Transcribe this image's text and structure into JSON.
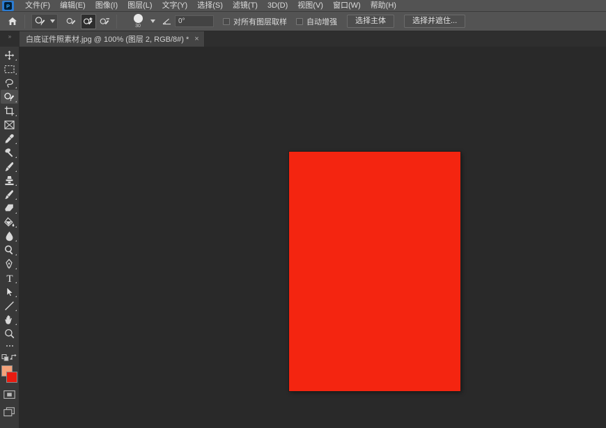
{
  "app": {
    "logo_icon": "photoshop-logo-icon",
    "accent_color": "#2b7cd3",
    "ui_bg": "#535353",
    "workspace_bg": "#292929"
  },
  "menubar": {
    "items": [
      {
        "label": "文件(F)",
        "name": "menu-file"
      },
      {
        "label": "编辑(E)",
        "name": "menu-edit"
      },
      {
        "label": "图像(I)",
        "name": "menu-image"
      },
      {
        "label": "图层(L)",
        "name": "menu-layer"
      },
      {
        "label": "文字(Y)",
        "name": "menu-type"
      },
      {
        "label": "选择(S)",
        "name": "menu-select"
      },
      {
        "label": "滤镜(T)",
        "name": "menu-filter"
      },
      {
        "label": "3D(D)",
        "name": "menu-3d"
      },
      {
        "label": "视图(V)",
        "name": "menu-view"
      },
      {
        "label": "窗口(W)",
        "name": "menu-window"
      },
      {
        "label": "帮助(H)",
        "name": "menu-help"
      }
    ]
  },
  "options_bar": {
    "home_icon": "home-icon",
    "tool_preview_icon": "quick-selection-tool-icon",
    "tool_preview_chevron": "chevron-down-icon",
    "modes": [
      {
        "name": "new-selection-mode",
        "icon": "quick-selection-new-icon",
        "active": false
      },
      {
        "name": "add-to-selection-mode",
        "icon": "quick-selection-add-icon",
        "active": true
      },
      {
        "name": "subtract-from-selection-mode",
        "icon": "quick-selection-subtract-icon",
        "active": false
      }
    ],
    "brush_size": "30",
    "brush_chevron": "chevron-down-icon",
    "angle_icon": "angle-icon",
    "angle_value": "0°",
    "checkboxes": [
      {
        "label": "对所有图层取样",
        "name": "sample-all-layers-checkbox",
        "checked": false
      },
      {
        "label": "自动增强",
        "name": "auto-enhance-checkbox",
        "checked": false
      }
    ],
    "buttons": [
      {
        "label": "选择主体",
        "name": "select-subject-button"
      },
      {
        "label": "选择并遮住...",
        "name": "select-and-mask-button"
      }
    ]
  },
  "tabbar": {
    "collapse_icon": "collapse-panel-icon",
    "collapse_label": "»",
    "document": {
      "title": "白底证件照素材.jpg @ 100% (图层 2, RGB/8#) *",
      "close_label": "×"
    }
  },
  "toolbar": {
    "tools": [
      {
        "name": "move-tool",
        "icon": "move-icon",
        "active": false,
        "has_submenu": true
      },
      {
        "name": "rectangular-marquee-tool",
        "icon": "marquee-icon",
        "active": false,
        "has_submenu": true
      },
      {
        "name": "lasso-tool",
        "icon": "lasso-icon",
        "active": false,
        "has_submenu": true
      },
      {
        "name": "quick-selection-tool",
        "icon": "quick-selection-icon",
        "active": true,
        "has_submenu": true
      },
      {
        "name": "crop-tool",
        "icon": "crop-icon",
        "active": false,
        "has_submenu": true
      },
      {
        "name": "frame-tool",
        "icon": "frame-icon",
        "active": false,
        "has_submenu": false
      },
      {
        "name": "eyedropper-tool",
        "icon": "eyedropper-icon",
        "active": false,
        "has_submenu": true
      },
      {
        "name": "spot-healing-brush-tool",
        "icon": "healing-brush-icon",
        "active": false,
        "has_submenu": true
      },
      {
        "name": "brush-tool",
        "icon": "brush-icon",
        "active": false,
        "has_submenu": true
      },
      {
        "name": "clone-stamp-tool",
        "icon": "clone-stamp-icon",
        "active": false,
        "has_submenu": true
      },
      {
        "name": "history-brush-tool",
        "icon": "history-brush-icon",
        "active": false,
        "has_submenu": true
      },
      {
        "name": "eraser-tool",
        "icon": "eraser-icon",
        "active": false,
        "has_submenu": true
      },
      {
        "name": "gradient-tool",
        "icon": "gradient-bucket-icon",
        "active": false,
        "has_submenu": true
      },
      {
        "name": "blur-tool",
        "icon": "blur-droplet-icon",
        "active": false,
        "has_submenu": true
      },
      {
        "name": "dodge-tool",
        "icon": "dodge-icon",
        "active": false,
        "has_submenu": true
      },
      {
        "name": "pen-tool",
        "icon": "pen-icon",
        "active": false,
        "has_submenu": true
      },
      {
        "name": "type-tool",
        "icon": "type-t-icon",
        "active": false,
        "has_submenu": true
      },
      {
        "name": "path-selection-tool",
        "icon": "path-arrow-icon",
        "active": false,
        "has_submenu": true
      },
      {
        "name": "line-tool",
        "icon": "line-shape-icon",
        "active": false,
        "has_submenu": true
      },
      {
        "name": "hand-tool",
        "icon": "hand-icon",
        "active": false,
        "has_submenu": true
      },
      {
        "name": "zoom-tool",
        "icon": "magnifier-icon",
        "active": false,
        "has_submenu": false
      }
    ],
    "more_tools": {
      "name": "edit-toolbar-button",
      "icon": "ellipsis-icon"
    },
    "default_colors": {
      "name": "default-colors-button",
      "icon": "default-colors-icon"
    },
    "swap_colors": {
      "name": "swap-colors-button",
      "icon": "swap-arrows-icon"
    },
    "foreground_color": "#f4a27a",
    "background_color": "#e81b10",
    "quick_mask": {
      "name": "quick-mask-button",
      "icon": "quick-mask-icon"
    },
    "screen_mode": {
      "name": "screen-mode-button",
      "icon": "screen-mode-icon"
    }
  },
  "canvas": {
    "document_fill_color": "#f42510",
    "zoom_level": "100%"
  }
}
